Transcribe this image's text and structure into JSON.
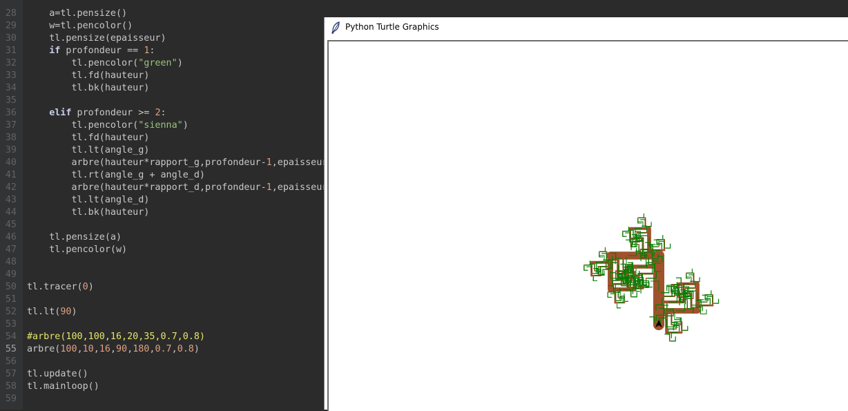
{
  "turtle_window": {
    "title": "Python Turtle Graphics",
    "title_icon": "feather-icon",
    "tree_colors": {
      "trunk": "#a0522d",
      "leaves": "#008000"
    },
    "cursor_color": "#000000"
  },
  "editor": {
    "colors": {
      "background": "#2b2b2b",
      "gutter": "#313335"
    },
    "lines": [
      {
        "n": "28",
        "tokens": [
          [
            "    a=tl.pensize()",
            "pl"
          ]
        ]
      },
      {
        "n": "29",
        "tokens": [
          [
            "    w=tl.pencolor()",
            "pl"
          ]
        ]
      },
      {
        "n": "30",
        "tokens": [
          [
            "    tl.pensize(epaisseur)",
            "pl"
          ]
        ]
      },
      {
        "n": "31",
        "tokens": [
          [
            "    ",
            "pl"
          ],
          [
            "if",
            "kw"
          ],
          [
            " profondeur == ",
            "pl"
          ],
          [
            "1",
            "num"
          ],
          [
            ":",
            "pl"
          ]
        ]
      },
      {
        "n": "32",
        "tokens": [
          [
            "        tl.pencolor(",
            "pl"
          ],
          [
            "\"green\"",
            "str"
          ],
          [
            ")",
            "pl"
          ]
        ]
      },
      {
        "n": "33",
        "tokens": [
          [
            "        tl.fd(hauteur)",
            "pl"
          ]
        ]
      },
      {
        "n": "34",
        "tokens": [
          [
            "        tl.bk(hauteur)",
            "pl"
          ]
        ]
      },
      {
        "n": "35",
        "tokens": []
      },
      {
        "n": "36",
        "tokens": [
          [
            "    ",
            "pl"
          ],
          [
            "elif",
            "kw"
          ],
          [
            " profondeur >= ",
            "pl"
          ],
          [
            "2",
            "num"
          ],
          [
            ":",
            "pl"
          ]
        ]
      },
      {
        "n": "37",
        "tokens": [
          [
            "        tl.pencolor(",
            "pl"
          ],
          [
            "\"sienna\"",
            "str"
          ],
          [
            ")",
            "pl"
          ]
        ]
      },
      {
        "n": "38",
        "tokens": [
          [
            "        tl.fd(hauteur)",
            "pl"
          ]
        ]
      },
      {
        "n": "39",
        "tokens": [
          [
            "        tl.lt(angle_g)",
            "pl"
          ]
        ]
      },
      {
        "n": "40",
        "tokens": [
          [
            "        arbre(hauteur*rapport_g,profondeur-",
            "pl"
          ],
          [
            "1",
            "num"
          ],
          [
            ",epaisseur",
            "pl"
          ]
        ]
      },
      {
        "n": "41",
        "tokens": [
          [
            "        tl.rt(angle_g + angle_d)",
            "pl"
          ]
        ]
      },
      {
        "n": "42",
        "tokens": [
          [
            "        arbre(hauteur*rapport_d,profondeur-",
            "pl"
          ],
          [
            "1",
            "num"
          ],
          [
            ",epaisseur",
            "pl"
          ]
        ]
      },
      {
        "n": "43",
        "tokens": [
          [
            "        tl.lt(angle_d)",
            "pl"
          ]
        ]
      },
      {
        "n": "44",
        "tokens": [
          [
            "        tl.bk(hauteur)",
            "pl"
          ]
        ]
      },
      {
        "n": "45",
        "tokens": []
      },
      {
        "n": "46",
        "tokens": [
          [
            "    tl.pensize(a)",
            "pl"
          ]
        ]
      },
      {
        "n": "47",
        "tokens": [
          [
            "    tl.pencolor(w)",
            "pl"
          ]
        ]
      },
      {
        "n": "48",
        "tokens": []
      },
      {
        "n": "49",
        "tokens": []
      },
      {
        "n": "50",
        "tokens": [
          [
            "tl.tracer(",
            "pl"
          ],
          [
            "0",
            "num"
          ],
          [
            ")",
            "pl"
          ]
        ]
      },
      {
        "n": "51",
        "tokens": []
      },
      {
        "n": "52",
        "tokens": [
          [
            "tl.lt(",
            "pl"
          ],
          [
            "90",
            "num"
          ],
          [
            ")",
            "pl"
          ]
        ]
      },
      {
        "n": "53",
        "tokens": []
      },
      {
        "n": "54",
        "tokens": [
          [
            "#arbre(100,100,16,20,35,0.7,0.8)",
            "cmt"
          ]
        ]
      },
      {
        "n": "55",
        "current": true,
        "tokens": [
          [
            "arbre(",
            "pl"
          ],
          [
            "100",
            "num"
          ],
          [
            ",",
            "pl"
          ],
          [
            "10",
            "num"
          ],
          [
            ",",
            "pl"
          ],
          [
            "16",
            "num"
          ],
          [
            ",",
            "pl"
          ],
          [
            "90",
            "num"
          ],
          [
            ",",
            "pl"
          ],
          [
            "180",
            "num"
          ],
          [
            ",",
            "pl"
          ],
          [
            "0.7",
            "num"
          ],
          [
            ",",
            "pl"
          ],
          [
            "0.8",
            "num"
          ],
          [
            ")",
            "pl"
          ]
        ]
      },
      {
        "n": "56",
        "tokens": []
      },
      {
        "n": "57",
        "tokens": [
          [
            "tl.update()",
            "pl"
          ]
        ]
      },
      {
        "n": "58",
        "tokens": [
          [
            "tl.mainloop()",
            "pl"
          ]
        ]
      },
      {
        "n": "59",
        "tokens": []
      }
    ]
  }
}
